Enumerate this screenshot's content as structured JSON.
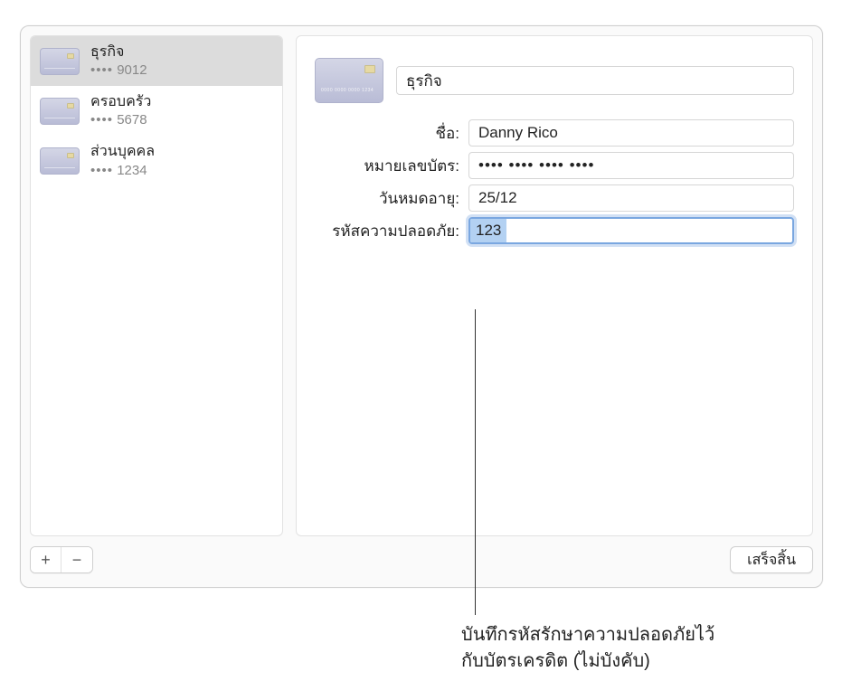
{
  "sidebar": {
    "items": [
      {
        "title": "ธุรกิจ",
        "mask_prefix": "••••",
        "last4": "9012",
        "selected": true
      },
      {
        "title": "ครอบครัว",
        "mask_prefix": "••••",
        "last4": "5678",
        "selected": false
      },
      {
        "title": "ส่วนบุคคล",
        "mask_prefix": "••••",
        "last4": "1234",
        "selected": false
      }
    ]
  },
  "detail": {
    "title_value": "ธุรกิจ",
    "labels": {
      "name": "ชื่อ:",
      "card_number": "หมายเลขบัตร:",
      "expiry": "วันหมดอายุ:",
      "security_code": "รหัสความปลอดภัย:"
    },
    "values": {
      "name": "Danny Rico",
      "card_number_masked": "•••• •••• •••• ••••",
      "expiry": "25/12",
      "security_code": "123"
    }
  },
  "footer": {
    "add_label": "+",
    "remove_label": "−",
    "done_label": "เสร็จสิ้น"
  },
  "callout": {
    "line1": "บันทึกรหัสรักษาความปลอดภัยไว้",
    "line2": "กับบัตรเครดิต (ไม่บังคับ)"
  }
}
